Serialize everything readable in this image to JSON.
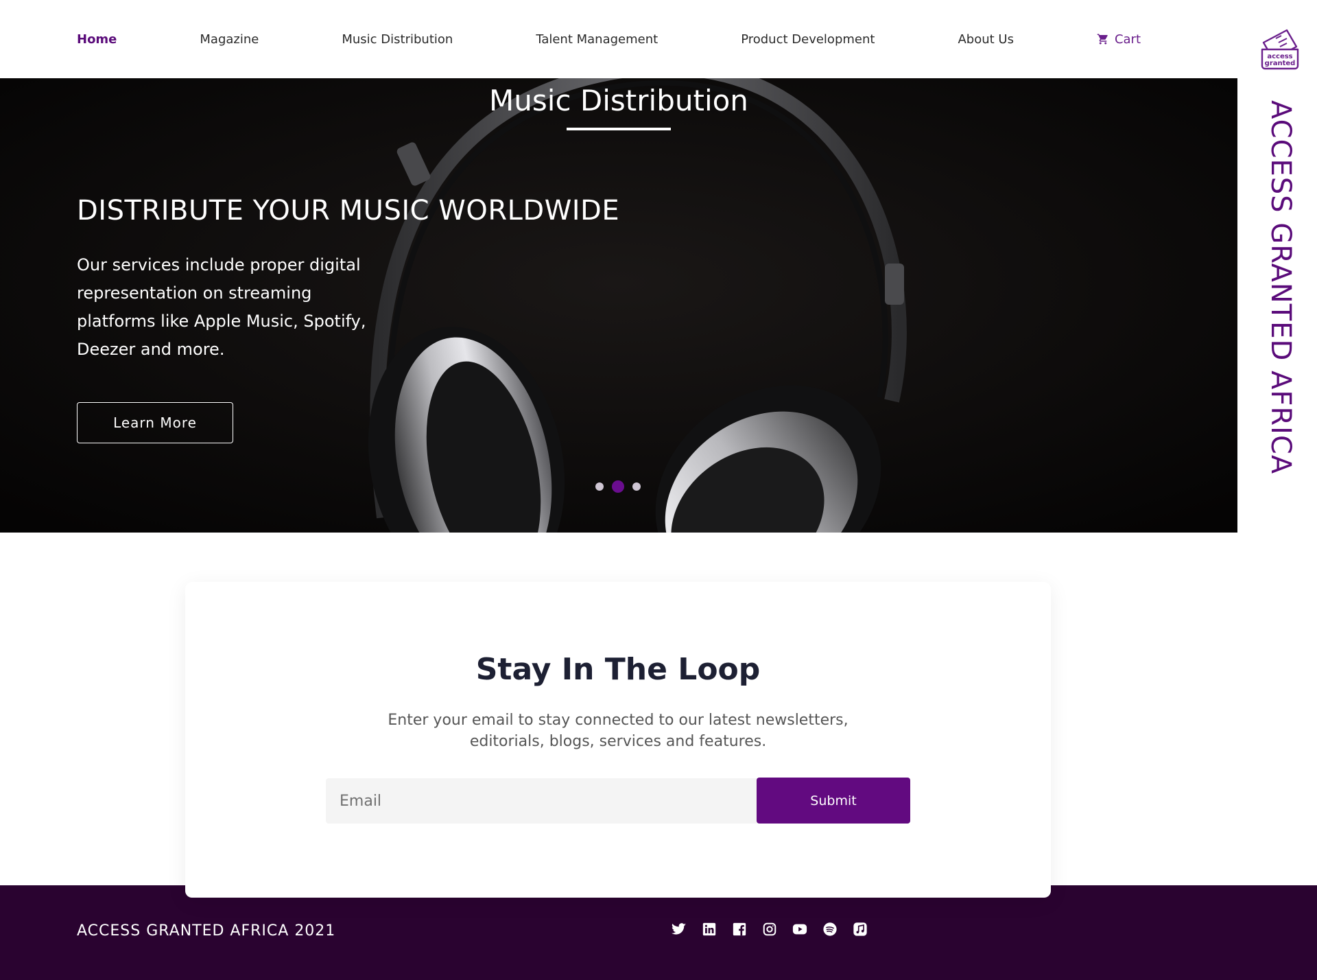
{
  "nav": {
    "items": [
      {
        "label": "Home",
        "active": true
      },
      {
        "label": "Magazine"
      },
      {
        "label": "Music Distribution"
      },
      {
        "label": "Talent Management"
      },
      {
        "label": "Product Development"
      },
      {
        "label": "About Us"
      }
    ],
    "cart_label": "Cart"
  },
  "brand": {
    "vertical_text": "ACCESS GRANTED AFRICA",
    "logo_text_line1": "access",
    "logo_text_line2": "granted",
    "color": "#5a0b7a"
  },
  "hero": {
    "title": "Music Distribution",
    "headline": "DISTRIBUTE YOUR MUSIC WORLDWIDE",
    "body": "Our services include proper digital representation on streaming platforms like Apple Music, Spotify, Deezer and more.",
    "cta_label": "Learn More",
    "slides_count": 3,
    "active_slide": 2
  },
  "newsletter": {
    "title": "Stay In The Loop",
    "description": "Enter your email to stay connected to our latest newsletters, editorials, blogs, services and features.",
    "email_placeholder": "Email",
    "submit_label": "Submit",
    "accent_color": "#620a80"
  },
  "footer": {
    "copyright": "ACCESS GRANTED AFRICA 2021",
    "background": "#2a0330",
    "social_icons": [
      "twitter-icon",
      "linkedin-icon",
      "facebook-icon",
      "instagram-icon",
      "youtube-icon",
      "spotify-icon",
      "apple-music-icon"
    ]
  }
}
